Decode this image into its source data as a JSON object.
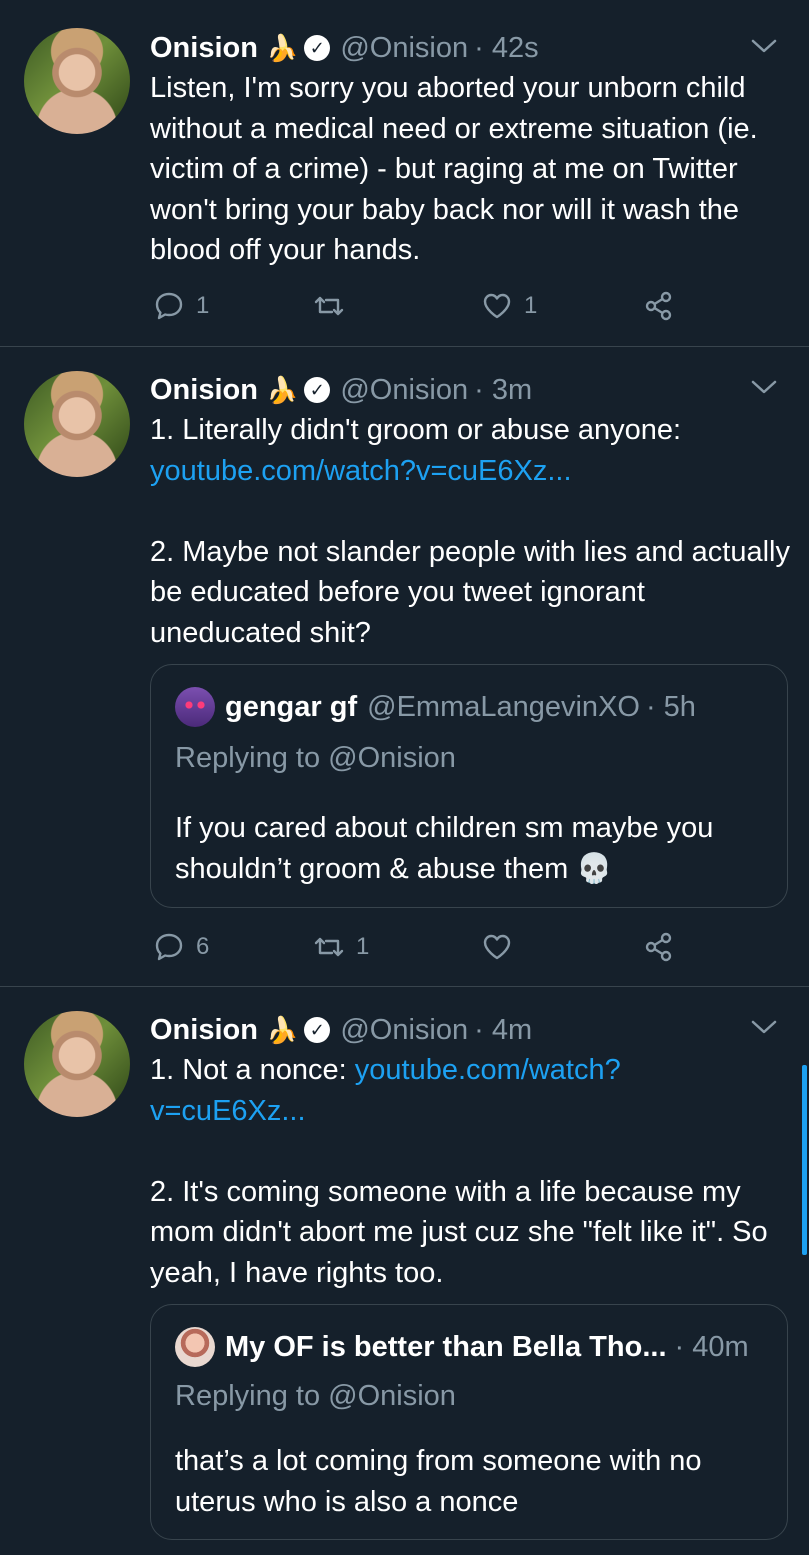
{
  "tweets": [
    {
      "name": "Onision",
      "handle": "@Onision",
      "time": "· 42s",
      "text": "Listen, I'm sorry you aborted your unborn child without a medical need or extreme situation (ie. victim of a crime) - but raging at me on Twitter won't bring your baby back nor will it wash the blood off your hands.",
      "replies": "1",
      "retweets": "",
      "likes": "1"
    },
    {
      "name": "Onision",
      "handle": "@Onision",
      "time": "· 3m",
      "line1": "1. Literally didn't groom or abuse anyone:",
      "link": "youtube.com/watch?v=cuE6Xz...",
      "line2": "2. Maybe not slander people with lies and actually be educated before you tweet ignorant uneducated shit?",
      "quote": {
        "name": "gengar gf",
        "handle": "@EmmaLangevinXO",
        "time": "· 5h",
        "replying": "Replying to @Onision",
        "text": "If you cared about children sm maybe you shouldn’t groom & abuse them 💀"
      },
      "replies": "6",
      "retweets": "1",
      "likes": ""
    },
    {
      "name": "Onision",
      "handle": "@Onision",
      "time": "· 4m",
      "line1_prefix": "1. Not a nonce: ",
      "link_a": "youtube.com/watch?",
      "link_b": "v=cuE6Xz...",
      "line2": "2. It's coming someone with a life because my mom didn't abort me just cuz she \"felt like it\". So yeah, I have rights too.",
      "quote": {
        "name": "My OF is better than Bella Tho...",
        "time": "· 40m",
        "replying": "Replying to @Onision",
        "text": "that’s a lot coming from someone with no uterus who is also a nonce"
      }
    }
  ],
  "icons": {
    "reply": "reply-icon",
    "retweet": "retweet-icon",
    "like": "like-icon",
    "share": "share-icon",
    "more": "chevron-down-icon",
    "verified": "verified-badge-icon",
    "emoji": "banana-emoji-icon"
  },
  "colors": {
    "background": "#15202b",
    "text": "#ffffff",
    "muted": "#8899a6",
    "link": "#1da1f2",
    "border": "#38444d"
  }
}
